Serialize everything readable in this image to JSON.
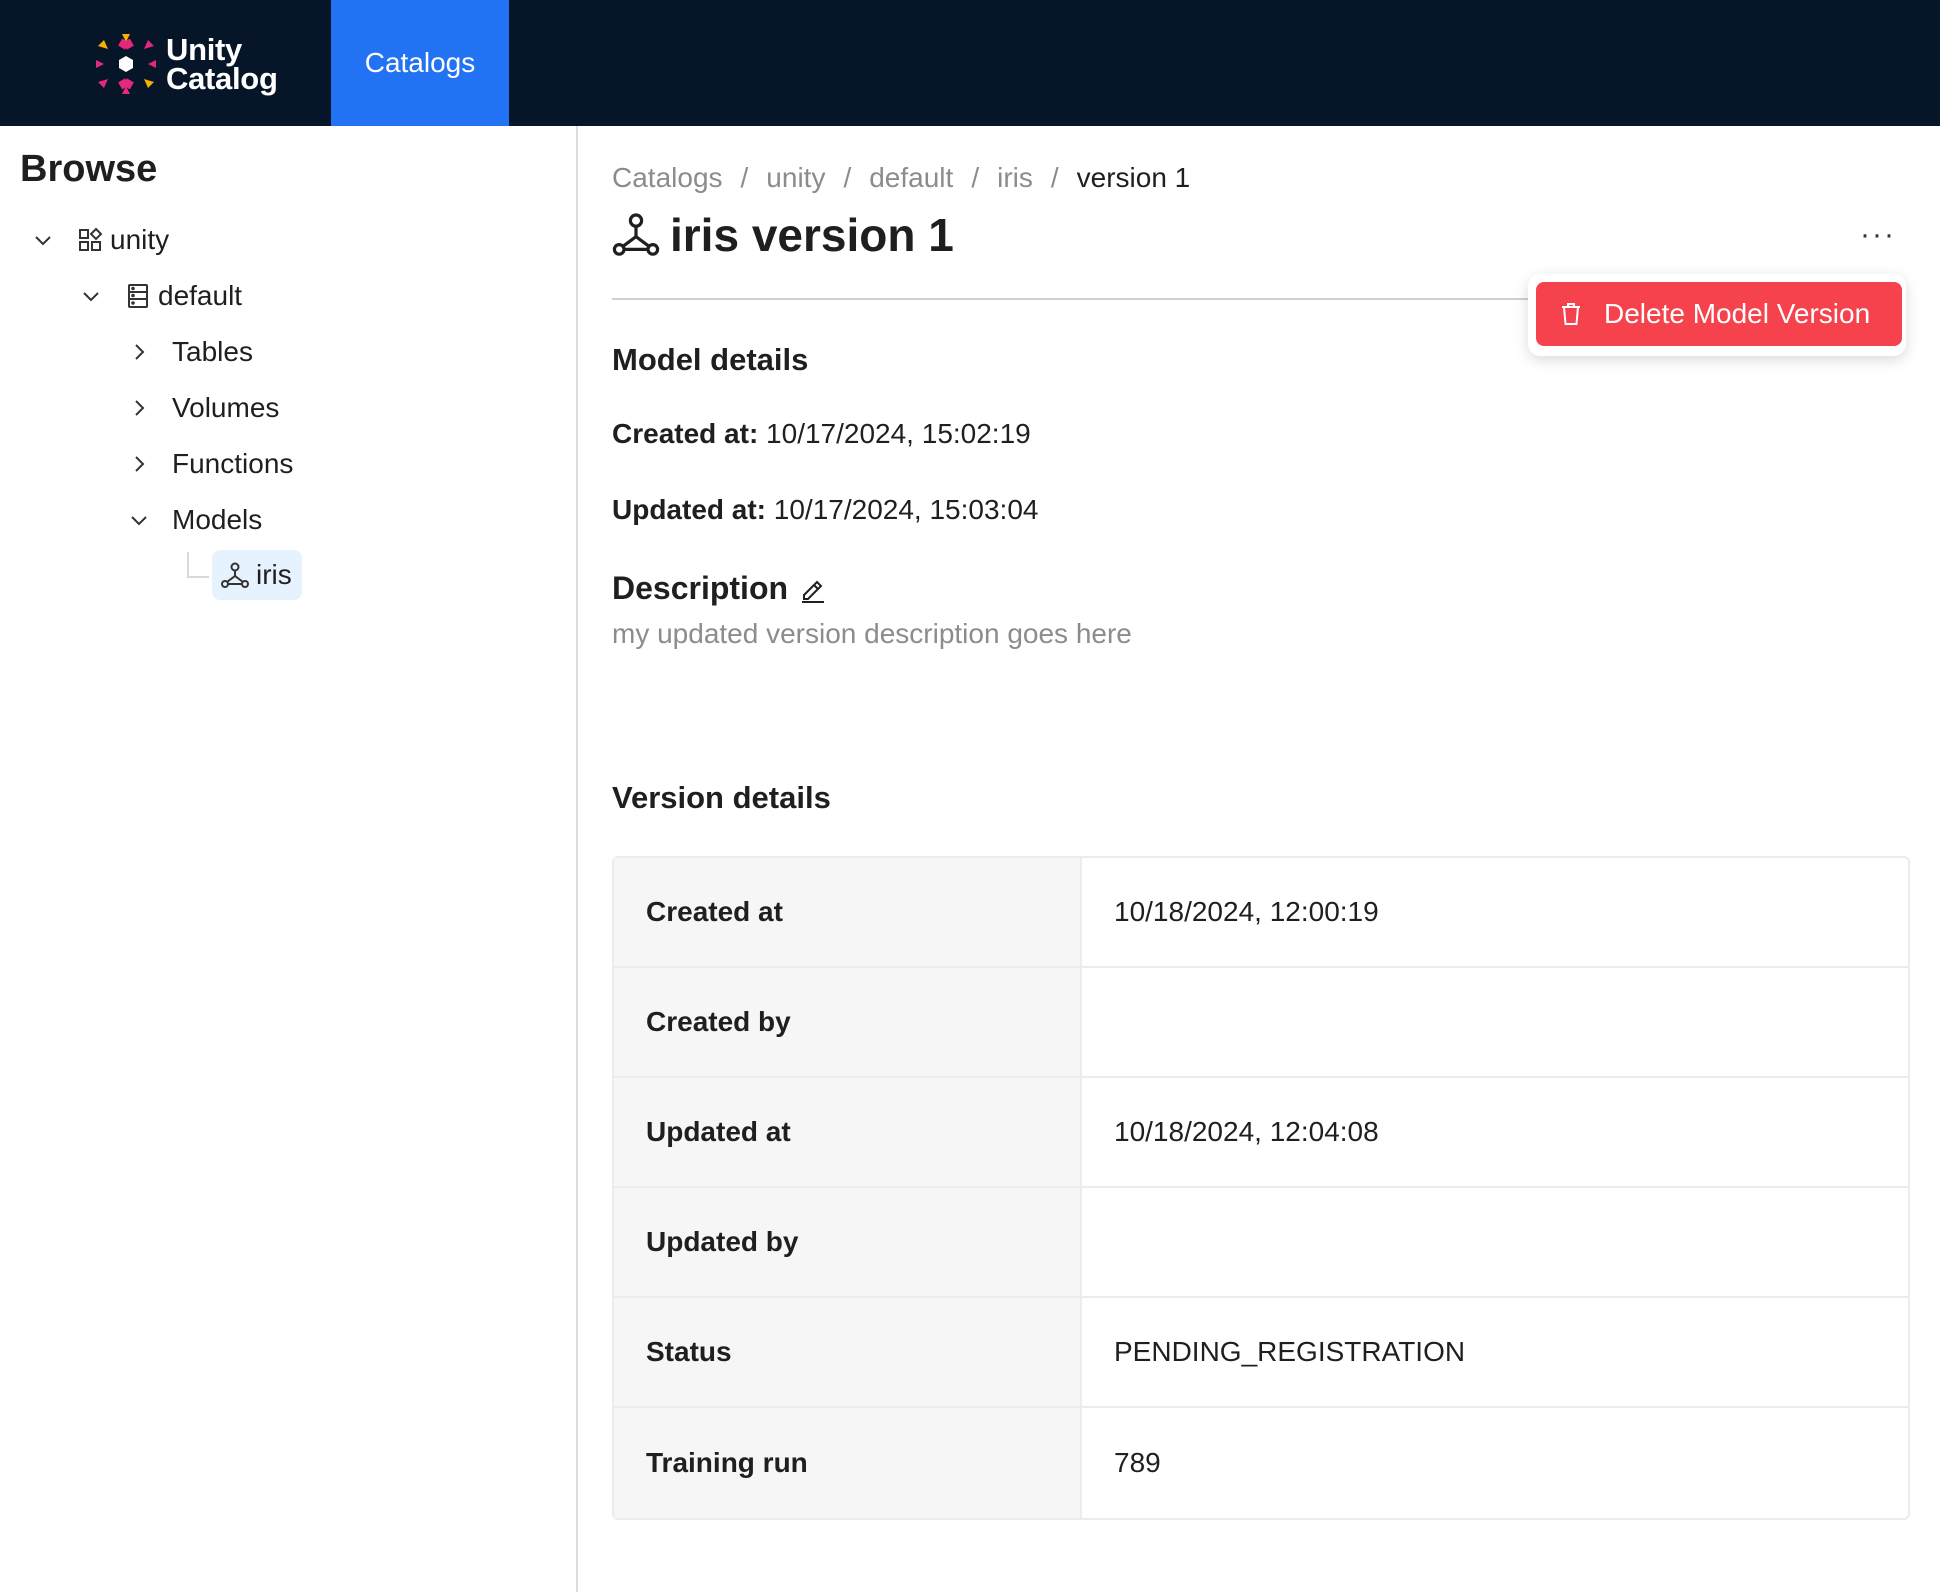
{
  "header": {
    "logo_line1": "Unity",
    "logo_line2": "Catalog",
    "nav_tab": "Catalogs"
  },
  "sidebar": {
    "title": "Browse",
    "tree": {
      "catalog": "unity",
      "schema": "default",
      "groups": [
        "Tables",
        "Volumes",
        "Functions",
        "Models"
      ],
      "selected_model": "iris"
    }
  },
  "breadcrumb": {
    "items": [
      "Catalogs",
      "unity",
      "default",
      "iris"
    ],
    "current": "version 1",
    "separator": "/"
  },
  "page": {
    "title": "iris version 1",
    "more_label": "···",
    "delete_label": "Delete Model Version"
  },
  "model_details": {
    "heading": "Model details",
    "created_label": "Created at:",
    "created_value": "10/17/2024, 15:02:19",
    "updated_label": "Updated at:",
    "updated_value": "10/17/2024, 15:03:04",
    "description_heading": "Description",
    "description_text": "my updated version description goes here"
  },
  "version_details": {
    "heading": "Version details",
    "rows": [
      {
        "key": "Created at",
        "value": "10/18/2024, 12:00:19"
      },
      {
        "key": "Created by",
        "value": ""
      },
      {
        "key": "Updated at",
        "value": "10/18/2024, 12:04:08"
      },
      {
        "key": "Updated by",
        "value": ""
      },
      {
        "key": "Status",
        "value": "PENDING_REGISTRATION"
      },
      {
        "key": "Training run",
        "value": "789"
      }
    ]
  },
  "colors": {
    "topbar": "#061528",
    "nav_active": "#2272f4",
    "danger": "#f5424c",
    "selected_bg": "#e6f2fd"
  }
}
